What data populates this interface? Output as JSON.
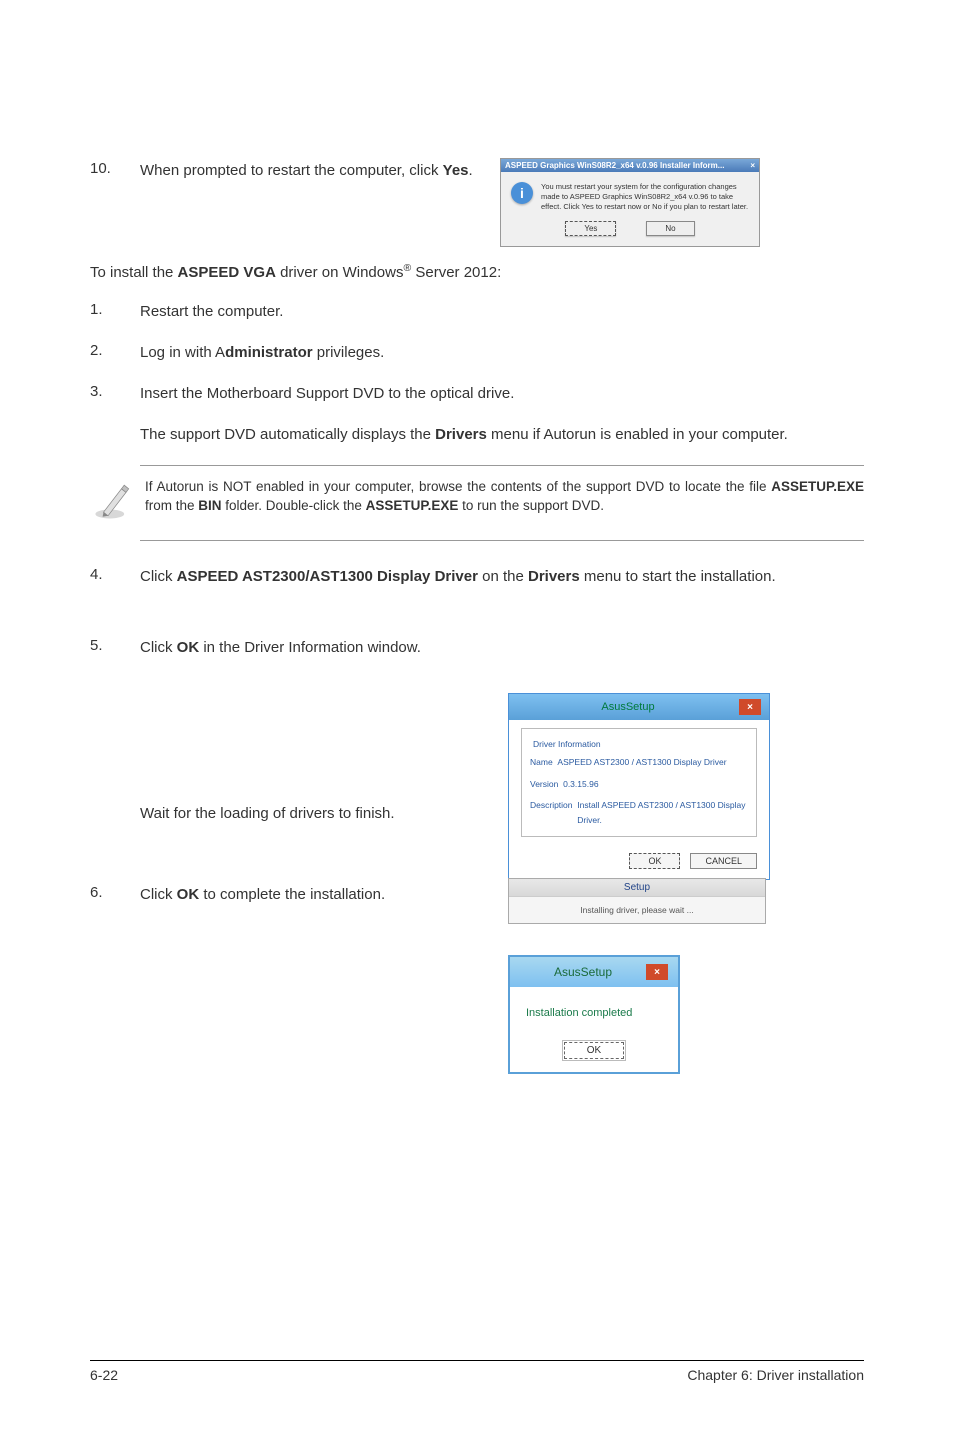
{
  "steps": {
    "s10": {
      "num": "10.",
      "text_pre": "When prompted to restart the computer, click ",
      "bold": "Yes",
      "text_post": "."
    },
    "s1": {
      "num": "1.",
      "text": "Restart the computer."
    },
    "s2": {
      "num": "2.",
      "text_pre": "Log in with A",
      "bold": "dministrator",
      "text_post": " privileges."
    },
    "s3": {
      "num": "3.",
      "text": "Insert the Motherboard Support DVD to the optical drive."
    },
    "s4": {
      "num": "4.",
      "text_pre": "Click ",
      "bold1": "ASPEED AST2300/AST1300 Display Driver",
      "mid": " on the ",
      "bold2": "Drivers",
      "text_post": " menu to start the installation."
    },
    "s5": {
      "num": "5.",
      "text_pre": "Click ",
      "bold": "OK",
      "text_post": " in the Driver Information window."
    },
    "s6": {
      "num": "6.",
      "text_pre": "Click ",
      "bold": "OK",
      "text_post": " to complete the installation."
    }
  },
  "intro": {
    "pre": "To install the ",
    "bold": "ASPEED VGA",
    "mid": " driver on Windows",
    "sup": "®",
    "post": " Server 2012:"
  },
  "sub3": {
    "pre": "The support DVD automatically displays the ",
    "bold": "Drivers",
    "post": " menu if Autorun is enabled in your computer."
  },
  "note": {
    "p1": "If Autorun is NOT enabled in your computer, browse the contents of the support DVD to locate the file ",
    "b1": "ASSETUP.EXE",
    "p2": " from the ",
    "b2": "BIN",
    "p3": " folder. Double-click the ",
    "b3": "ASSETUP.EXE",
    "p4": " to run the support DVD."
  },
  "wait_text": "Wait for the loading of drivers to finish.",
  "dialog_restart": {
    "title": "ASPEED Graphics WinS08R2_x64 v.0.96 Installer Inform...",
    "close": "×",
    "msg": "You must restart your system for the configuration changes made to ASPEED Graphics WinS08R2_x64 v.0.96 to take effect. Click Yes to restart now or No if you plan to restart later.",
    "yes": "Yes",
    "no": "No"
  },
  "dialog_asus": {
    "title": "AsusSetup",
    "close": "×",
    "legend": "Driver Information",
    "name_label": "Name",
    "name_val": "ASPEED AST2300 / AST1300 Display Driver",
    "version_label": "Version",
    "version_val": "0.3.15.96",
    "desc_label": "Description",
    "desc_val": "Install ASPEED AST2300 / AST1300 Display Driver.",
    "ok": "OK",
    "cancel": "CANCEL"
  },
  "dialog_setup": {
    "title": "Setup",
    "msg": "Installing driver, please wait ..."
  },
  "dialog_complete": {
    "title": "AsusSetup",
    "close": "×",
    "msg": "Installation completed",
    "ok": "OK"
  },
  "footer": {
    "left": "6-22",
    "right": "Chapter 6: Driver installation"
  }
}
